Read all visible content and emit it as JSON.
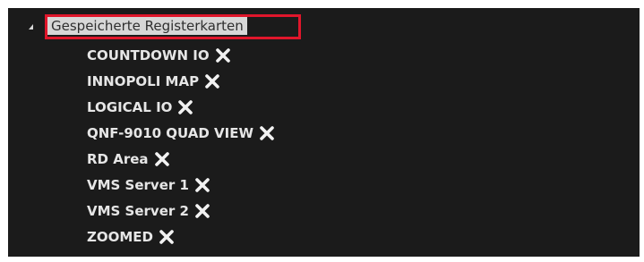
{
  "tree": {
    "header_label": "Gespeicherte Registerkarten",
    "expander_icon": "expanded-triangle-icon",
    "highlight_color": "#e0162b",
    "items": [
      {
        "label": "COUNTDOWN IO",
        "icon": "close-icon"
      },
      {
        "label": "INNOPOLI MAP",
        "icon": "close-icon"
      },
      {
        "label": "LOGICAL IO",
        "icon": "close-icon"
      },
      {
        "label": "QNF-9010 QUAD VIEW",
        "icon": "close-icon"
      },
      {
        "label": "RD Area",
        "icon": "close-icon"
      },
      {
        "label": "VMS Server 1",
        "icon": "close-icon"
      },
      {
        "label": "VMS Server 2",
        "icon": "close-icon"
      },
      {
        "label": "ZOOMED",
        "icon": "close-icon"
      }
    ]
  }
}
